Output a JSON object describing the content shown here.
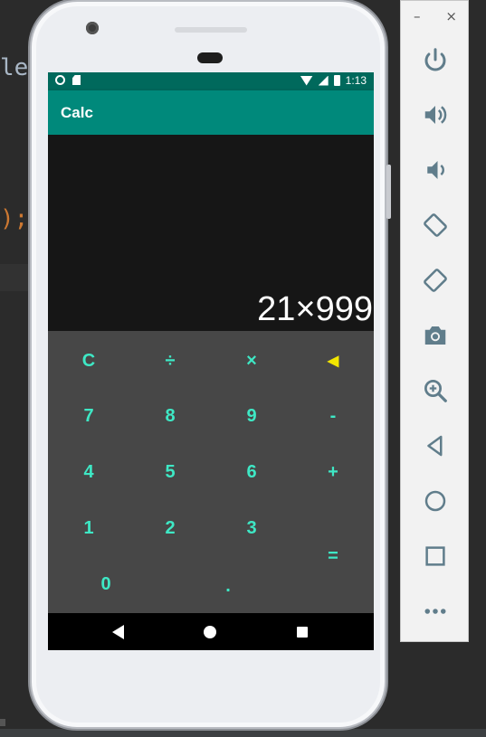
{
  "ide": {
    "code_line_1": "le",
    "code_line_2": ");"
  },
  "status_bar": {
    "time": "1:13"
  },
  "app": {
    "title": "Calc"
  },
  "display": {
    "expression": "21×999"
  },
  "keys": {
    "clear": "C",
    "divide": "÷",
    "multiply": "×",
    "backspace": "◀",
    "seven": "7",
    "eight": "8",
    "nine": "9",
    "minus": "-",
    "four": "4",
    "five": "5",
    "six": "6",
    "plus": "+",
    "one": "1",
    "two": "2",
    "three": "3",
    "equals": "=",
    "zero": "0",
    "dot": "."
  },
  "emulator_toolbar": {
    "minimize": "–",
    "close": "×",
    "buttons": [
      "power-icon",
      "volume-up-icon",
      "volume-down-icon",
      "rotate-left-icon",
      "rotate-right-icon",
      "camera-icon",
      "zoom-icon",
      "back-icon",
      "home-icon",
      "overview-icon",
      "more-icon"
    ]
  },
  "colors": {
    "accent": "#3ee8c5",
    "appbar": "#00897b",
    "statusbar": "#00695c",
    "backspace": "#f2e600",
    "keypad": "#474747"
  }
}
